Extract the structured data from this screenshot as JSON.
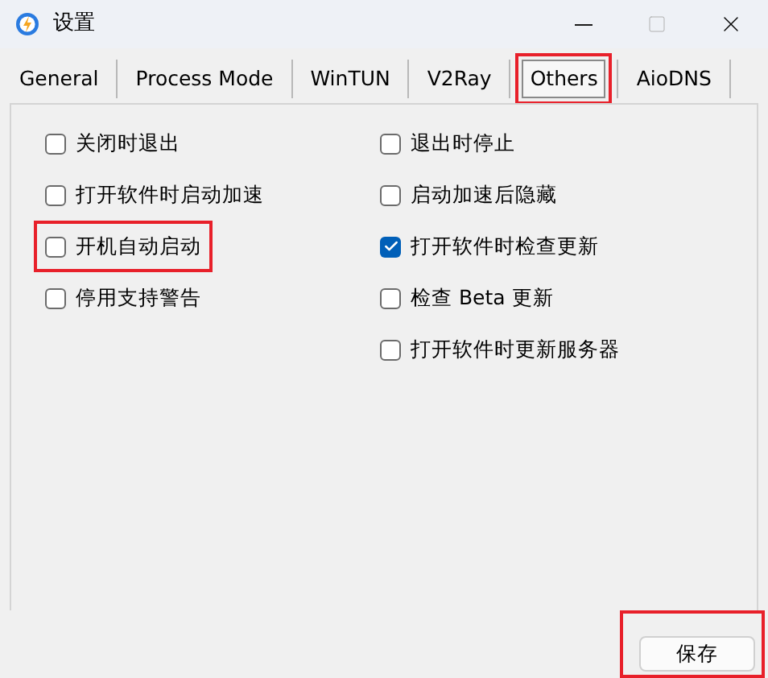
{
  "window": {
    "title": "设置"
  },
  "tabs": [
    {
      "label": "General",
      "selected": false,
      "highlighted": false
    },
    {
      "label": "Process Mode",
      "selected": false,
      "highlighted": false
    },
    {
      "label": "WinTUN",
      "selected": false,
      "highlighted": false
    },
    {
      "label": "V2Ray",
      "selected": false,
      "highlighted": false
    },
    {
      "label": "Others",
      "selected": true,
      "highlighted": true
    },
    {
      "label": "AioDNS",
      "selected": false,
      "highlighted": false
    }
  ],
  "left_options": [
    {
      "label": "关闭时退出",
      "checked": false,
      "highlighted": false
    },
    {
      "label": "打开软件时启动加速",
      "checked": false,
      "highlighted": false
    },
    {
      "label": "开机自动启动",
      "checked": false,
      "highlighted": true
    },
    {
      "label": "停用支持警告",
      "checked": false,
      "highlighted": false
    }
  ],
  "right_options": [
    {
      "label": "退出时停止",
      "checked": false,
      "highlighted": false
    },
    {
      "label": "启动加速后隐藏",
      "checked": false,
      "highlighted": false
    },
    {
      "label": "打开软件时检查更新",
      "checked": true,
      "highlighted": false
    },
    {
      "label": "检查 Beta 更新",
      "checked": false,
      "highlighted": false
    },
    {
      "label": "打开软件时更新服务器",
      "checked": false,
      "highlighted": false
    }
  ],
  "save_button": {
    "label": "保存",
    "highlighted": true
  }
}
